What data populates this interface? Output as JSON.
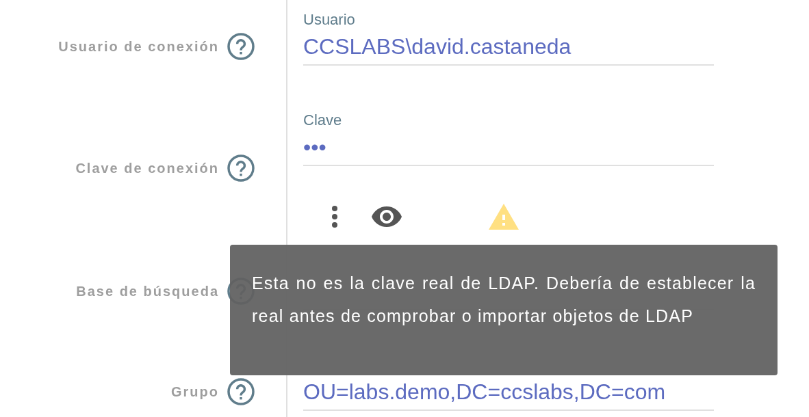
{
  "rows": [
    {
      "label": "Usuario de conexión",
      "field": {
        "label": "Usuario",
        "value": "CCSLABS\\david.castaneda"
      }
    },
    {
      "label": "Clave de conexión",
      "field": {
        "label": "Clave",
        "value": "•••"
      },
      "actions": [
        {
          "kind": "menu"
        },
        {
          "kind": "visibility"
        },
        {
          "kind": "warning"
        }
      ]
    },
    {
      "label": "Base de búsqueda"
    },
    {
      "label": "Grupo",
      "field": {
        "value": "OU=labs.demo,DC=ccslabs,DC=com"
      }
    }
  ],
  "tooltip": {
    "text": "Esta no es la clave real de LDAP. Debería de establecer la real antes de comprobar o importar objetos de LDAP"
  }
}
